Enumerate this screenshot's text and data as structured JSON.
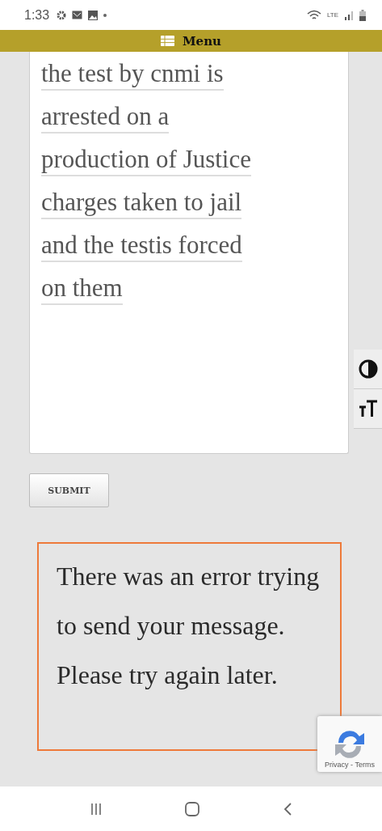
{
  "status_bar": {
    "time": "1:33",
    "network": "LTE"
  },
  "menu": {
    "label": "Menu"
  },
  "message_field": {
    "lines": [
      "the test by cnmi is",
      "arrested on a",
      "production of Justice",
      "charges taken to jail",
      "and the testis forced",
      "on them"
    ]
  },
  "submit": {
    "label": "SUBMIT"
  },
  "error": {
    "text": "There was an error trying to send your message. Please try again later."
  },
  "recaptcha": {
    "links": "Privacy - Terms"
  }
}
